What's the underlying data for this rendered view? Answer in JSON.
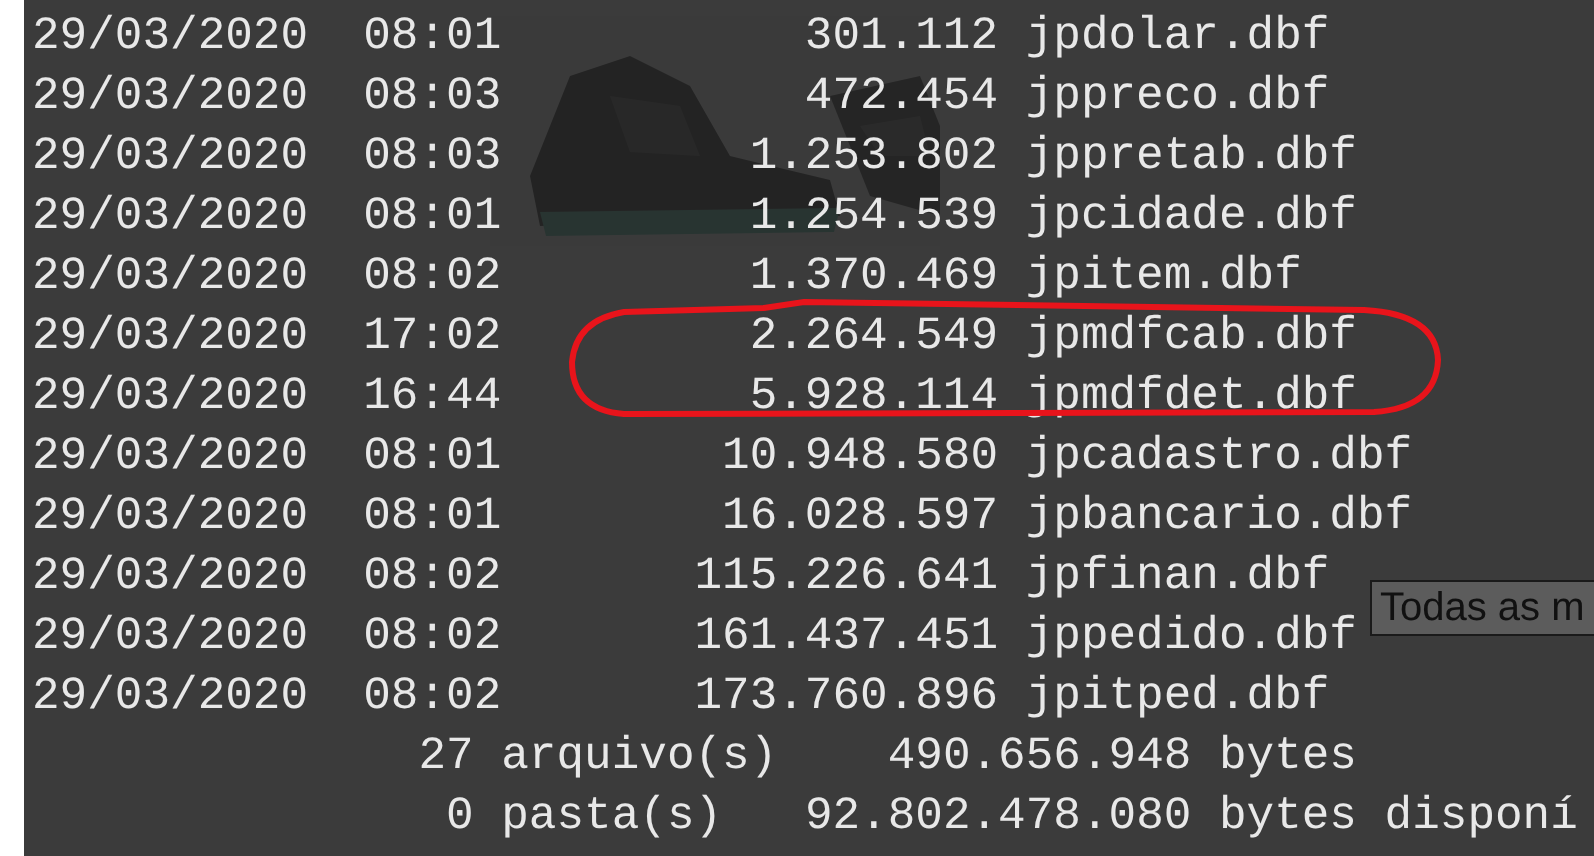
{
  "background_page": {
    "kind": "picture",
    "older_messages_select": "Todas as m"
  },
  "console": {
    "rows": [
      {
        "date": "29/03/2020",
        "time": "08:01",
        "size": "301.112",
        "name": "jpdolar.dbf"
      },
      {
        "date": "29/03/2020",
        "time": "08:03",
        "size": "472.454",
        "name": "jppreco.dbf"
      },
      {
        "date": "29/03/2020",
        "time": "08:03",
        "size": "1.253.802",
        "name": "jppretab.dbf"
      },
      {
        "date": "29/03/2020",
        "time": "08:01",
        "size": "1.254.539",
        "name": "jpcidade.dbf"
      },
      {
        "date": "29/03/2020",
        "time": "08:02",
        "size": "1.370.469",
        "name": "jpitem.dbf"
      },
      {
        "date": "29/03/2020",
        "time": "17:02",
        "size": "2.264.549",
        "name": "jpmdfcab.dbf"
      },
      {
        "date": "29/03/2020",
        "time": "16:44",
        "size": "5.928.114",
        "name": "jpmdfdet.dbf"
      },
      {
        "date": "29/03/2020",
        "time": "08:01",
        "size": "10.948.580",
        "name": "jpcadastro.dbf"
      },
      {
        "date": "29/03/2020",
        "time": "08:01",
        "size": "16.028.597",
        "name": "jpbancario.dbf"
      },
      {
        "date": "29/03/2020",
        "time": "08:02",
        "size": "115.226.641",
        "name": "jpfinan.dbf"
      },
      {
        "date": "29/03/2020",
        "time": "08:02",
        "size": "161.437.451",
        "name": "jppedido.dbf"
      },
      {
        "date": "29/03/2020",
        "time": "08:02",
        "size": "173.760.896",
        "name": "jpitped.dbf"
      }
    ],
    "summary": [
      {
        "count": "27",
        "label": "arquivo(s)",
        "bytes": "490.656.948",
        "unit": "bytes"
      },
      {
        "count": "0",
        "label": "pasta(s)",
        "bytes": "92.802.478.080",
        "unit": "bytes disponí"
      }
    ]
  }
}
